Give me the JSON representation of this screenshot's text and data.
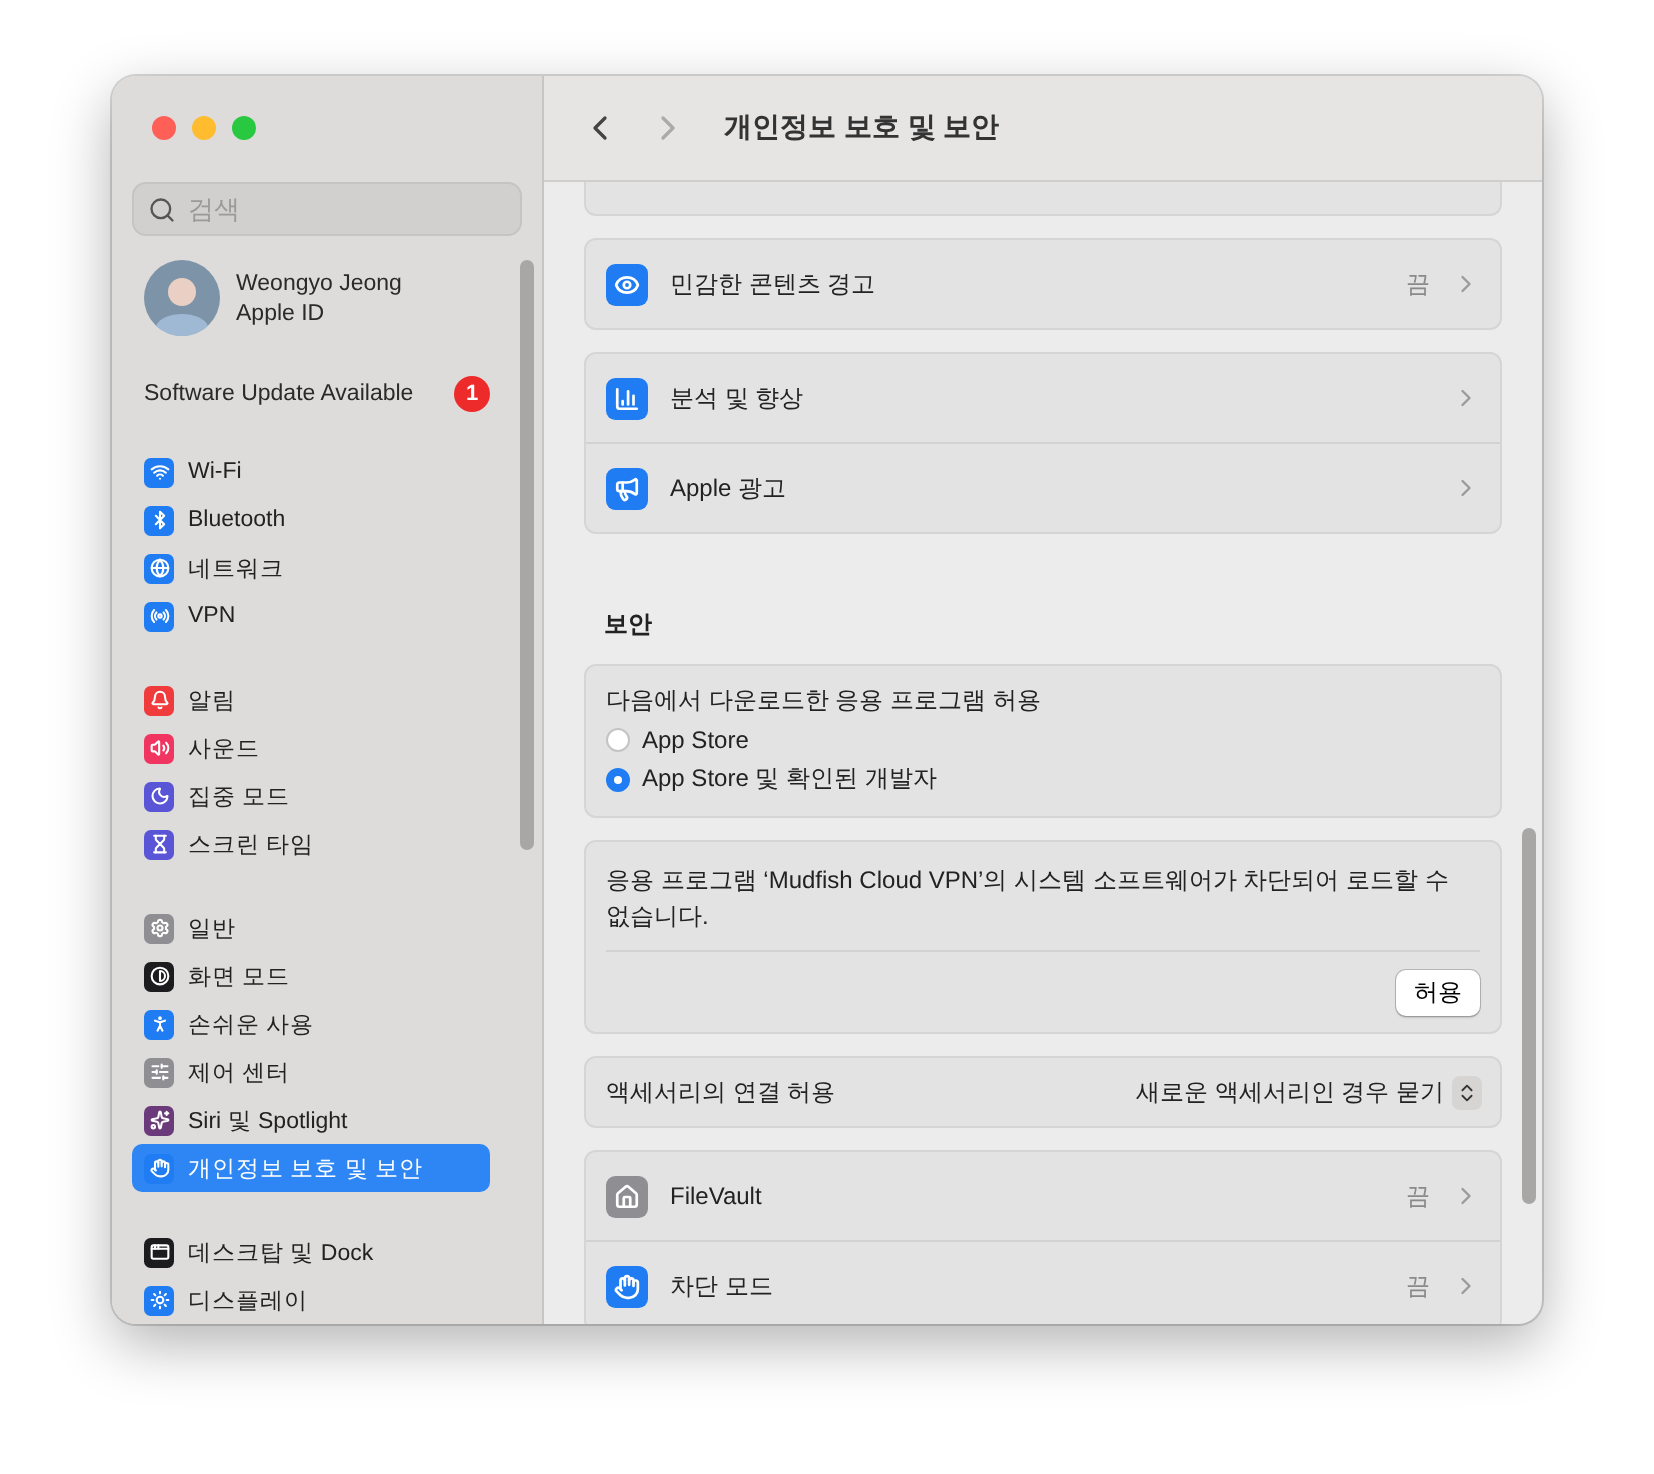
{
  "sidebar": {
    "search": {
      "placeholder": "검색"
    },
    "account": {
      "name": "Weongyo Jeong",
      "subtitle": "Apple ID"
    },
    "update": {
      "label": "Software Update Available",
      "badge": "1"
    },
    "groups": [
      [
        {
          "label": "Wi-Fi",
          "color": "#1f7cf2",
          "selected": false
        },
        {
          "label": "Bluetooth",
          "color": "#1f7cf2",
          "selected": false
        },
        {
          "label": "네트워크",
          "color": "#1f7cf2",
          "selected": false
        },
        {
          "label": "VPN",
          "color": "#1f7cf2",
          "selected": false
        }
      ],
      [
        {
          "label": "알림",
          "color": "#ef3b3b",
          "selected": false
        },
        {
          "label": "사운드",
          "color": "#ef3560",
          "selected": false
        },
        {
          "label": "집중 모드",
          "color": "#5a54d6",
          "selected": false
        },
        {
          "label": "스크린 타임",
          "color": "#5a54d6",
          "selected": false
        }
      ],
      [
        {
          "label": "일반",
          "color": "#8e8e93",
          "selected": false
        },
        {
          "label": "화면 모드",
          "color": "#1c1c1e",
          "selected": false
        },
        {
          "label": "손쉬운 사용",
          "color": "#1f7cf2",
          "selected": false
        },
        {
          "label": "제어 센터",
          "color": "#8e8e93",
          "selected": false
        },
        {
          "label": "Siri 및 Spotlight",
          "color": "#6a3a7a",
          "selected": false
        },
        {
          "label": "개인정보 보호 및 보안",
          "color": "#1f7cf2",
          "selected": true
        }
      ],
      [
        {
          "label": "데스크탑 및 Dock",
          "color": "#1c1c1e",
          "selected": false
        },
        {
          "label": "디스플레이",
          "color": "#1f7cf2",
          "selected": false
        }
      ]
    ]
  },
  "header": {
    "title": "개인정보 보호 및 보안"
  },
  "content": [
    {
      "kind": "partial"
    },
    {
      "kind": "list",
      "rows": [
        {
          "label": "민감한 콘텐츠 경고",
          "value": "끔",
          "color": "#1f7cf2"
        }
      ]
    },
    {
      "kind": "list",
      "rows": [
        {
          "label": "분석 및 향상",
          "color": "#1f7cf2"
        },
        {
          "label": "Apple 광고",
          "color": "#1f7cf2"
        }
      ]
    },
    {
      "kind": "heading",
      "text": "보안"
    },
    {
      "kind": "radio",
      "title": "다음에서 다운로드한 응용 프로그램 허용",
      "options": [
        {
          "label": "App Store",
          "selected": false
        },
        {
          "label": "App Store 및 확인된 개발자",
          "selected": true
        }
      ]
    },
    {
      "kind": "notice",
      "text": "응용 프로그램 ‘Mudfish Cloud VPN’의 시스템 소프트웨어가 차단되어 로드할 수 없습니다.",
      "button": "허용"
    },
    {
      "kind": "popup",
      "label": "액세서리의 연결 허용",
      "value": "새로운 액세서리인 경우 묻기"
    },
    {
      "kind": "list",
      "rows": [
        {
          "label": "FileVault",
          "value": "끔",
          "color": "#8e8e93"
        },
        {
          "label": "차단 모드",
          "value": "끔",
          "color": "#1f7cf2"
        }
      ]
    }
  ]
}
